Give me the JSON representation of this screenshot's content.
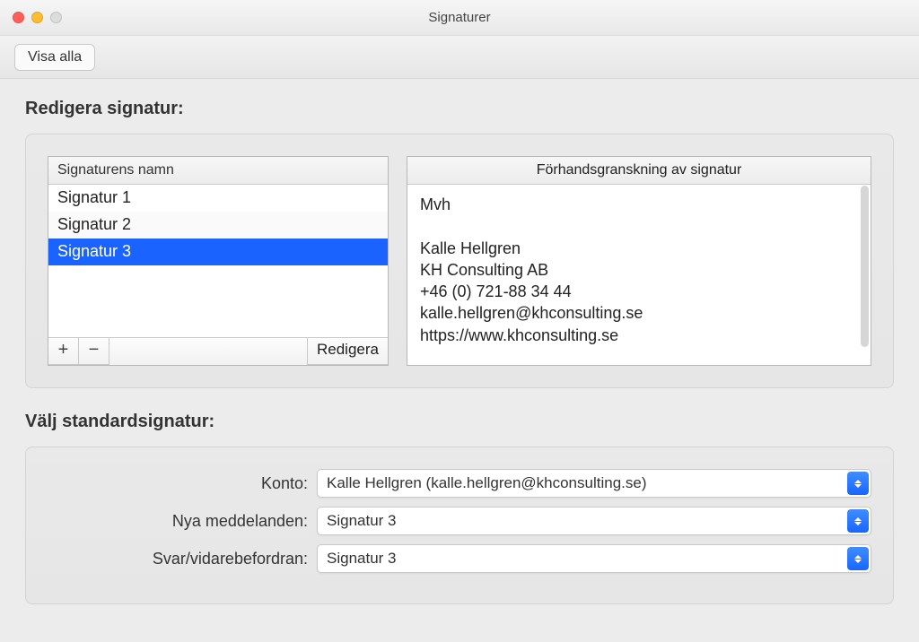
{
  "window": {
    "title": "Signaturer"
  },
  "toolbar": {
    "show_all": "Visa alla"
  },
  "edit_section": {
    "heading": "Redigera signatur:",
    "list_header": "Signaturens namn",
    "items": [
      "Signatur 1",
      "Signatur 2",
      "Signatur 3"
    ],
    "selected_index": 2,
    "edit_button": "Redigera",
    "preview_header": "Förhandsgranskning av signatur",
    "preview_body": "Mvh\n\nKalle Hellgren\nKH Consulting AB\n+46 (0) 721-88 34 44\nkalle.hellgren@khconsulting.se\nhttps://www.khconsulting.se"
  },
  "defaults_section": {
    "heading": "Välj standardsignatur:",
    "rows": [
      {
        "label": "Konto:",
        "value": "Kalle Hellgren (kalle.hellgren@khconsulting.se)"
      },
      {
        "label": "Nya meddelanden:",
        "value": "Signatur 3"
      },
      {
        "label": "Svar/vidarebefordran:",
        "value": "Signatur 3"
      }
    ]
  },
  "icons": {
    "plus": "+",
    "minus": "−"
  }
}
